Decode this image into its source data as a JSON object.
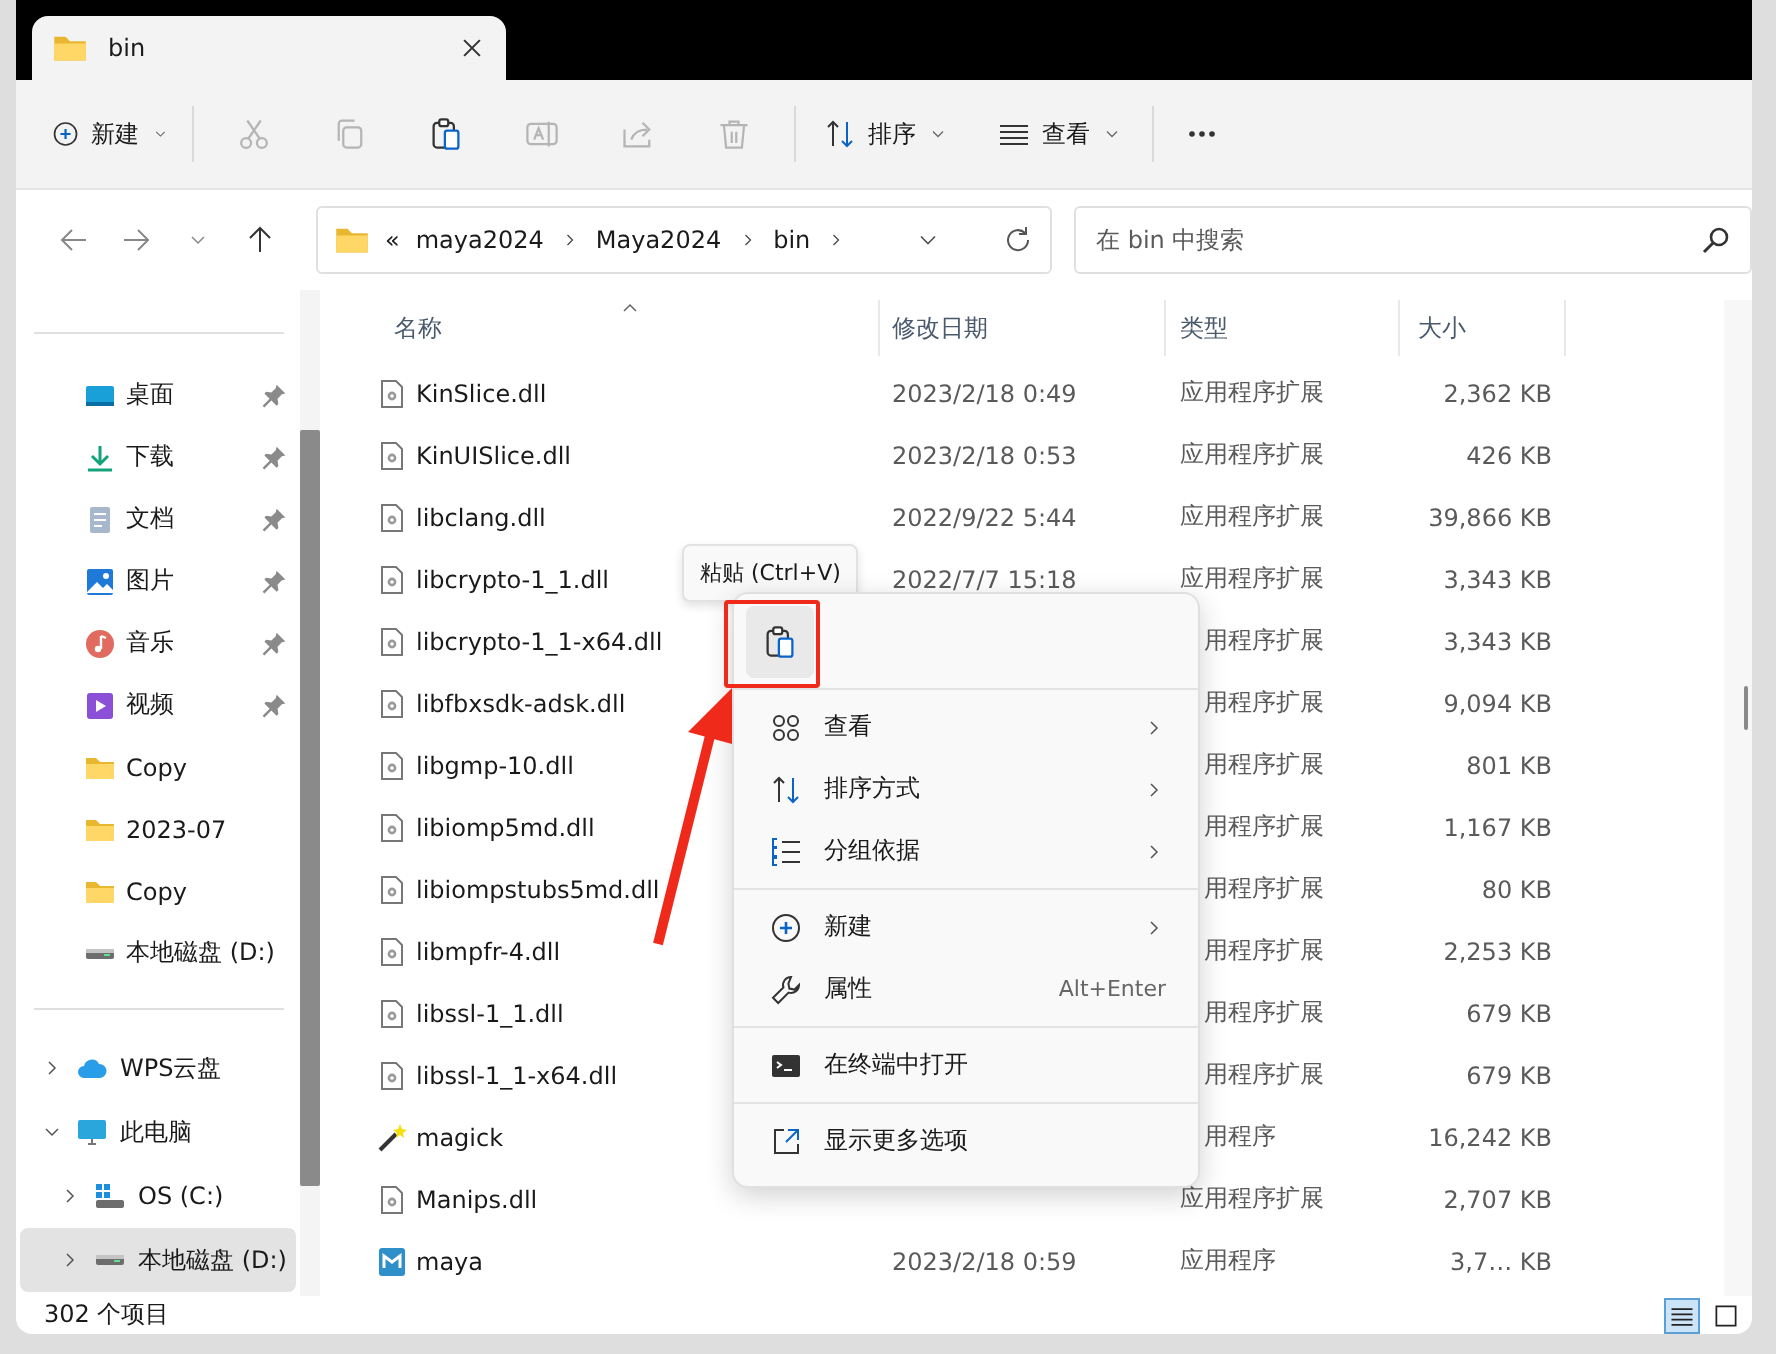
{
  "window": {
    "tab": {
      "title": "bin"
    }
  },
  "toolbar": {
    "items": [
      {
        "kind": "new",
        "label": "新建"
      },
      {
        "kind": "cut",
        "disabled": true
      },
      {
        "kind": "copy",
        "disabled": true
      },
      {
        "kind": "paste",
        "disabled": false
      },
      {
        "kind": "rename",
        "disabled": true
      },
      {
        "kind": "share",
        "disabled": true
      },
      {
        "kind": "delete",
        "disabled": true
      },
      {
        "kind": "sort",
        "label": "排序"
      },
      {
        "kind": "view",
        "label": "查看"
      },
      {
        "kind": "more"
      }
    ]
  },
  "address_bar": {
    "crumbs": [
      "«",
      "maya2024",
      "Maya2024",
      "bin"
    ],
    "search": {
      "placeholder": "在 bin 中搜索"
    }
  },
  "sidebar": {
    "quick_access": [
      {
        "label": "桌面",
        "kind": "desktop",
        "pinned": true
      },
      {
        "label": "下载",
        "kind": "download",
        "pinned": true
      },
      {
        "label": "文档",
        "kind": "document",
        "pinned": true
      },
      {
        "label": "图片",
        "kind": "picture",
        "pinned": true
      },
      {
        "label": "音乐",
        "kind": "music",
        "pinned": true
      },
      {
        "label": "视频",
        "kind": "video",
        "pinned": true
      },
      {
        "label": "Copy",
        "kind": "folder",
        "pinned": false
      },
      {
        "label": "2023-07",
        "kind": "folder",
        "pinned": false
      },
      {
        "label": "Copy",
        "kind": "folder",
        "pinned": false
      },
      {
        "label": "本地磁盘 (D:)",
        "kind": "drive",
        "pinned": false
      }
    ],
    "tree": [
      {
        "label": "WPS云盘",
        "kind": "cloud",
        "expanded": false,
        "selected": false
      },
      {
        "label": "此电脑",
        "kind": "monitor",
        "expanded": true,
        "selected": false,
        "children": [
          {
            "label": "OS (C:)",
            "kind": "osdrive",
            "expanded": false,
            "selected": false
          },
          {
            "label": "本地磁盘 (D:)",
            "kind": "drive",
            "expanded": false,
            "selected": true
          }
        ]
      }
    ]
  },
  "table": {
    "columns": [
      {
        "label": "名称",
        "sorted": true
      },
      {
        "label": "修改日期",
        "sorted": false
      },
      {
        "label": "类型",
        "sorted": false
      },
      {
        "label": "大小",
        "sorted": false
      }
    ],
    "rows": [
      {
        "kind": "dll",
        "name": "KinSlice.dll",
        "date": "2023/2/18 0:49",
        "type": "应用程序扩展",
        "size": "2,362 KB"
      },
      {
        "kind": "dll",
        "name": "KinUISlice.dll",
        "date": "2023/2/18 0:53",
        "type": "应用程序扩展",
        "size": "426 KB"
      },
      {
        "kind": "dll",
        "name": "libclang.dll",
        "date": "2022/9/22 5:44",
        "type": "应用程序扩展",
        "size": "39,866 KB"
      },
      {
        "kind": "dll",
        "name": "libcrypto-1_1.dll",
        "date": "2022/7/7 15:18",
        "type": "应用程序扩展",
        "size": "3,343 KB"
      },
      {
        "kind": "dll",
        "name": "libcrypto-1_1-x64.dll",
        "type": "用程序扩展",
        "size": "3,343 KB"
      },
      {
        "kind": "dll",
        "name": "libfbxsdk-adsk.dll",
        "type": "用程序扩展",
        "size": "9,094 KB"
      },
      {
        "kind": "dll",
        "name": "libgmp-10.dll",
        "type": "用程序扩展",
        "size": "801 KB"
      },
      {
        "kind": "dll",
        "name": "libiomp5md.dll",
        "type": "用程序扩展",
        "size": "1,167 KB"
      },
      {
        "kind": "dll",
        "name": "libiompstubs5md.dll",
        "type": "用程序扩展",
        "size": "80 KB"
      },
      {
        "kind": "dll",
        "name": "libmpfr-4.dll",
        "type": "用程序扩展",
        "size": "2,253 KB"
      },
      {
        "kind": "dll",
        "name": "libssl-1_1.dll",
        "type": "用程序扩展",
        "size": "679 KB"
      },
      {
        "kind": "dll",
        "name": "libssl-1_1-x64.dll",
        "type": "用程序扩展",
        "size": "679 KB"
      },
      {
        "kind": "wand",
        "name": "magick",
        "type": "用程序",
        "size": "16,242 KB"
      },
      {
        "kind": "dll",
        "name": "Manips.dll",
        "type": "应用程序扩展",
        "size": "2,707 KB"
      },
      {
        "kind": "maya",
        "name": "maya",
        "date": "2023/2/18 0:59",
        "type": "应用程序",
        "size": "3,7… KB"
      }
    ]
  },
  "tooltip": "粘贴 (Ctrl+V)",
  "context_menu": {
    "quick_actions": [
      {
        "kind": "paste",
        "annotated": true
      }
    ],
    "groups": [
      [
        {
          "kind": "grid",
          "label": "查看",
          "submenu": true
        },
        {
          "kind": "sort",
          "label": "排序方式",
          "submenu": true
        },
        {
          "kind": "group",
          "label": "分组依据",
          "submenu": true
        }
      ],
      [
        {
          "kind": "plus",
          "label": "新建",
          "submenu": true
        },
        {
          "kind": "wrench",
          "label": "属性",
          "shortcut": "Alt+Enter",
          "submenu": false
        }
      ],
      [
        {
          "kind": "terminal",
          "label": "在终端中打开",
          "submenu": false
        }
      ],
      [
        {
          "kind": "external",
          "label": "显示更多选项",
          "submenu": false
        }
      ]
    ]
  },
  "status_bar": {
    "count": "302 个项目",
    "views": [
      {
        "kind": "details",
        "selected": true
      },
      {
        "kind": "tiles",
        "selected": false
      }
    ]
  }
}
